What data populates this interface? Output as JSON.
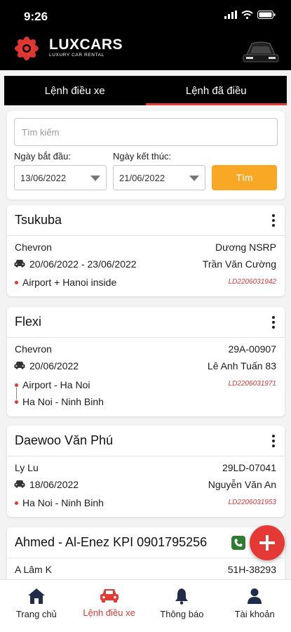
{
  "status": {
    "time": "9:26"
  },
  "brand": {
    "name": "LUXCARS",
    "tagline": "LUXURY CAR RENTAL"
  },
  "tabs": [
    {
      "label": "Lệnh điều xe",
      "active": false
    },
    {
      "label": "Lệnh đã điều",
      "active": true
    }
  ],
  "search": {
    "placeholder": "Tìm kiếm",
    "value": "",
    "start_label": "Ngày bắt đầu:",
    "start_value": "13/06/2022",
    "end_label": "Ngày kết thúc:",
    "end_value": "21/06/2022",
    "button_label": "Tìm"
  },
  "trips": [
    {
      "title": "Tsukuba",
      "company": "Chevron",
      "driver": "Dương NSRP",
      "dates": "20/06/2022 - 23/06/2022",
      "contact": "Trần Văn Cường",
      "code": "LD2206031942",
      "routes": [
        "Airport + Hanoi inside"
      ]
    },
    {
      "title": "Flexi",
      "company": "Chevron",
      "plate": "29A-00907",
      "dates": "20/06/2022",
      "driver": "Lê Anh Tuấn 83",
      "code": "LD2206031971",
      "routes": [
        "Airport - Ha Noi",
        "Ha Noi - Ninh Binh"
      ]
    },
    {
      "title": "Daewoo Văn Phú",
      "company": "Ly Lu",
      "plate": "29LD-07041",
      "dates": "18/06/2022",
      "driver": "Nguyễn Văn An",
      "code": "LD2206031953",
      "routes": [
        "Ha Noi - Ninh Binh"
      ]
    },
    {
      "title": "Ahmed - Al-Enez KPI 0901795256",
      "company": "A Lâm K",
      "plate": "51H-38293"
    }
  ],
  "bottom_nav": [
    {
      "label": "Trang chủ",
      "icon": "home-icon",
      "active": false
    },
    {
      "label": "Lệnh điều xe",
      "icon": "car-icon",
      "active": true
    },
    {
      "label": "Thông báo",
      "icon": "bell-icon",
      "active": false
    },
    {
      "label": "Tài khoản",
      "icon": "user-icon",
      "active": false
    }
  ],
  "colors": {
    "accent": "#e53935",
    "button": "#f9a825",
    "header": "#000000"
  }
}
